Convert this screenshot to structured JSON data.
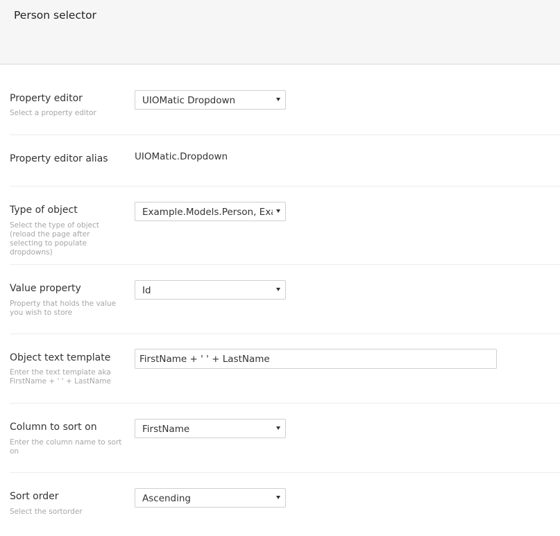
{
  "header": {
    "title": "Person selector"
  },
  "properties": [
    {
      "label": "Property editor",
      "description": "Select a property editor",
      "value": "UIOMatic Dropdown"
    },
    {
      "label": "Property editor alias",
      "value": "UIOMatic.Dropdown"
    },
    {
      "label": "Type of object",
      "description": "Select the type of object (reload the page after selecting to populate dropdowns)",
      "value": "Example.Models.Person, Example"
    },
    {
      "label": "Value property",
      "description": "Property that holds the value you wish to store",
      "value": "Id"
    },
    {
      "label": "Object text template",
      "description": "Enter the text template aka FirstName + ' ' + LastName",
      "value": "FirstName + ' ' + LastName"
    },
    {
      "label": "Column to sort on",
      "description": "Enter the column name to sort on",
      "value": "FirstName"
    },
    {
      "label": "Sort order",
      "description": "Select the sortorder",
      "value": "Ascending"
    }
  ],
  "icons": {
    "dropdown_arrow": "caret-down-icon"
  }
}
